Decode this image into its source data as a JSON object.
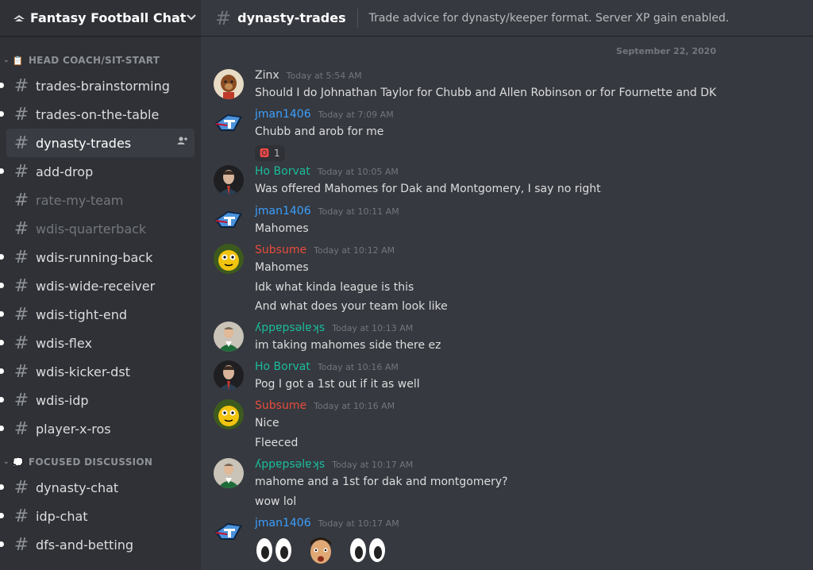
{
  "server": {
    "name": "Fantasy Football Chat"
  },
  "sidebar": {
    "categories": [
      {
        "label": "HEAD COACH/SIT-START",
        "channels": [
          {
            "name": "trades-brainstorming"
          },
          {
            "name": "trades-on-the-table"
          },
          {
            "name": "dynasty-trades"
          },
          {
            "name": "add-drop"
          },
          {
            "name": "rate-my-team"
          },
          {
            "name": "wdis-quarterback"
          },
          {
            "name": "wdis-running-back"
          },
          {
            "name": "wdis-wide-receiver"
          },
          {
            "name": "wdis-tight-end"
          },
          {
            "name": "wdis-flex"
          },
          {
            "name": "wdis-kicker-dst"
          },
          {
            "name": "wdis-idp"
          },
          {
            "name": "player-x-ros"
          }
        ]
      },
      {
        "label": "FOCUSED DISCUSSION",
        "channels": [
          {
            "name": "dynasty-chat"
          },
          {
            "name": "idp-chat"
          },
          {
            "name": "dfs-and-betting"
          }
        ]
      }
    ]
  },
  "header": {
    "channel": "dynasty-trades",
    "topic": "Trade advice for dynasty/keeper format. Server XP gain enabled."
  },
  "date_divider": "September 22, 2020",
  "colors": {
    "blurple": "#7289da",
    "author_blue": "#3b9fff",
    "author_teal": "#1abc9c",
    "author_red": "#e74c3c",
    "author_gray": "#dcddde"
  },
  "messages": [
    {
      "author": "Zinx",
      "time": "Today at 5:54 AM",
      "lines": [
        "Should I do Johnathan Taylor for Chubb and Allen Robinson or for Fournette and DK"
      ]
    },
    {
      "author": "jman1406",
      "time": "Today at 7:09 AM",
      "lines": [
        "Chubb and arob for me"
      ],
      "reaction": {
        "icon": "blood-type-o-emoji",
        "count": "1"
      }
    },
    {
      "author": "Ho Borvat",
      "time": "Today at 10:05 AM",
      "lines": [
        "Was offered Mahomes for Dak and Montgomery, I say no right"
      ]
    },
    {
      "author": "jman1406",
      "time": "Today at 10:11 AM",
      "lines": [
        "Mahomes"
      ]
    },
    {
      "author": "Subsume",
      "time": "Today at 10:12 AM",
      "lines": [
        "Mahomes",
        "Idk what kinda league is this",
        "And what does your team look like"
      ]
    },
    {
      "author": "ʎppɐpsǝlɐʞs",
      "time": "Today at 10:13 AM",
      "lines": [
        "im taking mahomes side there ez"
      ]
    },
    {
      "author": "Ho Borvat",
      "time": "Today at 10:16 AM",
      "lines": [
        "Pog I got a 1st out if it as well"
      ]
    },
    {
      "author": "Subsume",
      "time": "Today at 10:16 AM",
      "lines": [
        "Nice",
        "Fleeced"
      ]
    },
    {
      "author": "ʎppɐpsǝlɐʞs",
      "time": "Today at 10:17 AM",
      "lines": [
        "mahome and a 1st for dak and montgomery?",
        "wow lol"
      ]
    },
    {
      "author": "jman1406",
      "time": "Today at 10:17 AM",
      "emojis": [
        "eyes-emoji",
        "face-emoji",
        "eyes-emoji"
      ]
    }
  ]
}
